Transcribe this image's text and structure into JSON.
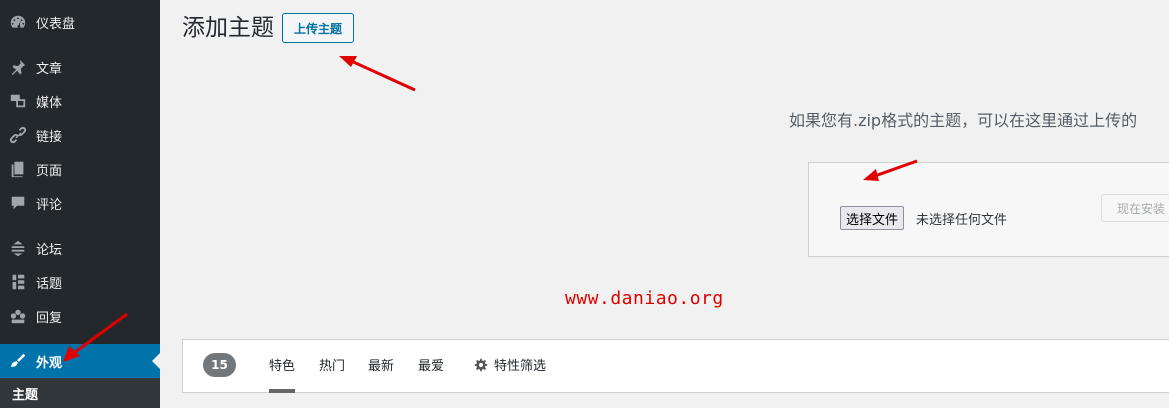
{
  "sidebar": {
    "items": [
      {
        "label": "仪表盘",
        "icon": "dashboard-icon"
      },
      {
        "label": "文章",
        "icon": "pin-icon"
      },
      {
        "label": "媒体",
        "icon": "media-icon"
      },
      {
        "label": "链接",
        "icon": "link-icon"
      },
      {
        "label": "页面",
        "icon": "page-icon"
      },
      {
        "label": "评论",
        "icon": "comment-icon"
      },
      {
        "label": "论坛",
        "icon": "forum-icon"
      },
      {
        "label": "话题",
        "icon": "topic-icon"
      },
      {
        "label": "回复",
        "icon": "reply-icon"
      },
      {
        "label": "外观",
        "icon": "brush-icon",
        "active": true
      }
    ],
    "submenu": {
      "label": "主题"
    }
  },
  "main": {
    "title": "添加主题",
    "upload_button": "上传主题",
    "upload_description": "如果您有.zip格式的主题，可以在这里通过上传的",
    "choose_file_button": "选择文件",
    "no_file_text": "未选择任何文件",
    "install_button": "现在安装",
    "watermark": "www.daniao.org"
  },
  "filter_bar": {
    "count": "15",
    "tabs": [
      "特色",
      "热门",
      "最新",
      "最爱"
    ],
    "feature_filter": "特性筛选"
  },
  "colors": {
    "sidebar_bg": "#23282d",
    "active_bg": "#0073aa",
    "accent": "#0071a1",
    "arrow": "#e00000"
  }
}
